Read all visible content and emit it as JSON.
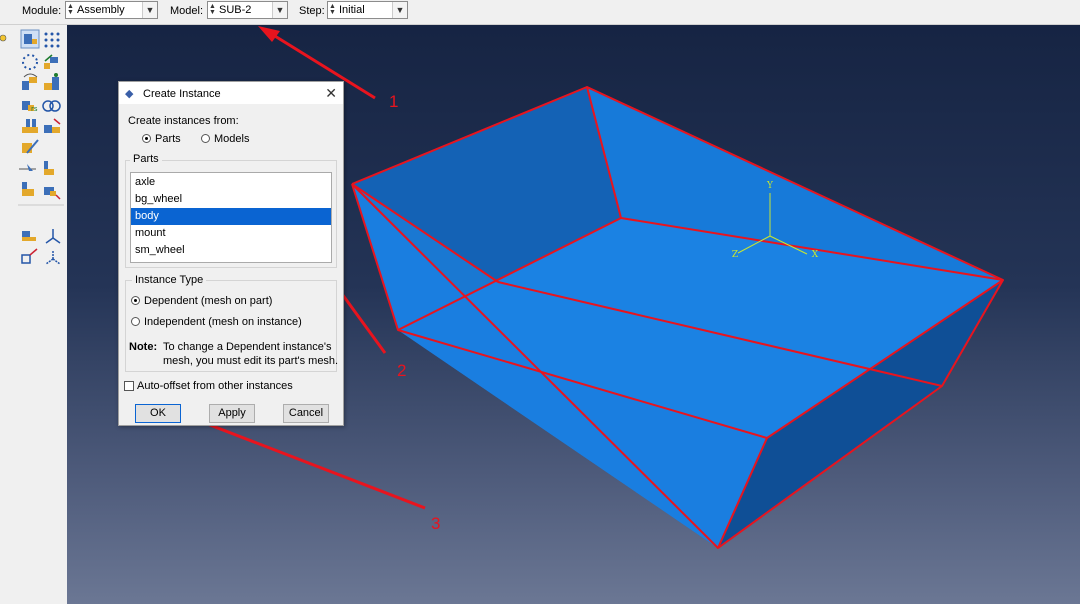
{
  "toolbar": {
    "module_label": "Module:",
    "module_value": "Assembly",
    "model_label": "Model:",
    "model_value": "SUB-2",
    "step_label": "Step:",
    "step_value": "Initial"
  },
  "dialog": {
    "title": "Create Instance",
    "create_from_label": "Create instances from:",
    "source_options": [
      "Parts",
      "Models"
    ],
    "source_selected": "Parts",
    "parts_group_label": "Parts",
    "parts": [
      "axle",
      "bg_wheel",
      "body",
      "mount",
      "sm_wheel"
    ],
    "selected_part": "body",
    "instance_type_label": "Instance Type",
    "instance_types": [
      "Dependent (mesh on part)",
      "Independent (mesh on instance)"
    ],
    "instance_type_selected": "Dependent (mesh on part)",
    "note_label": "Note:",
    "note_line1": "To change a Dependent instance's",
    "note_line2": "mesh, you must edit its part's mesh.",
    "auto_offset_label": "Auto-offset from other instances",
    "auto_offset_checked": false,
    "ok_label": "OK",
    "apply_label": "Apply",
    "cancel_label": "Cancel"
  },
  "axes": {
    "y": "Y",
    "x": "X",
    "z": "Z"
  },
  "annotations": [
    "1",
    "2",
    "3"
  ],
  "colors": {
    "viewport_top": "#162443",
    "viewport_bottom": "#6b7794",
    "body_fill": "#1b82e3",
    "edge": "#e8141e",
    "annotation": "#e8141e",
    "axis": "#c8e632",
    "selection": "#0a64d2"
  }
}
